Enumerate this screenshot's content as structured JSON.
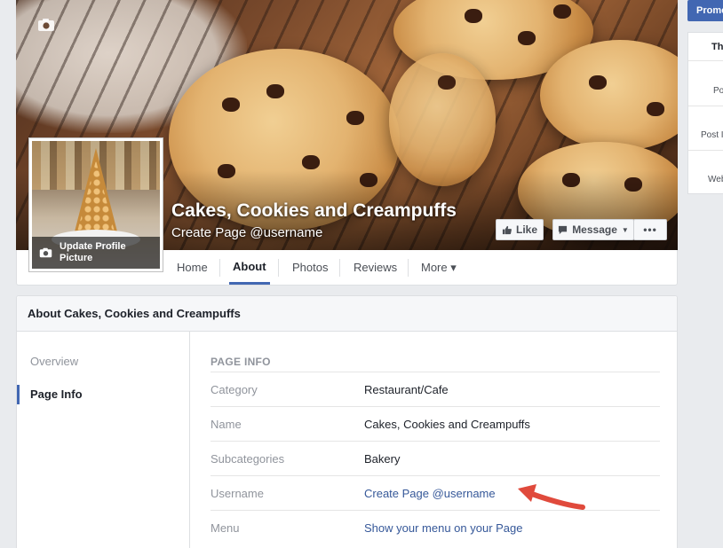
{
  "page": {
    "name": "Cakes, Cookies and Creampuffs",
    "username_prompt": "Create Page @username"
  },
  "profile": {
    "update_label": "Update Profile Picture"
  },
  "actions": {
    "like": "Like",
    "message": "Message",
    "more": "•••"
  },
  "nav": [
    {
      "label": "Home"
    },
    {
      "label": "About"
    },
    {
      "label": "Photos"
    },
    {
      "label": "Reviews"
    },
    {
      "label": "More ▾"
    }
  ],
  "about": {
    "header": "About Cakes, Cookies and Creampuffs",
    "menu": [
      {
        "label": "Overview"
      },
      {
        "label": "Page Info"
      }
    ],
    "section_title": "PAGE INFO",
    "rows": [
      {
        "key": "Category",
        "value": "Restaurant/Cafe"
      },
      {
        "key": "Name",
        "value": "Cakes, Cookies and Creampuffs"
      },
      {
        "key": "Subcategories",
        "value": "Bakery"
      },
      {
        "key": "Username",
        "value": "Create Page @username"
      },
      {
        "key": "Menu",
        "value": "Show your menu on your Page"
      }
    ]
  },
  "sidebar": {
    "promote": "Promo",
    "header": "Th",
    "items": [
      "Po",
      "Post I",
      "Web"
    ]
  },
  "colors": {
    "accent": "#4267b2",
    "link": "#365899",
    "annotation_arrow": "#e04a3c"
  }
}
